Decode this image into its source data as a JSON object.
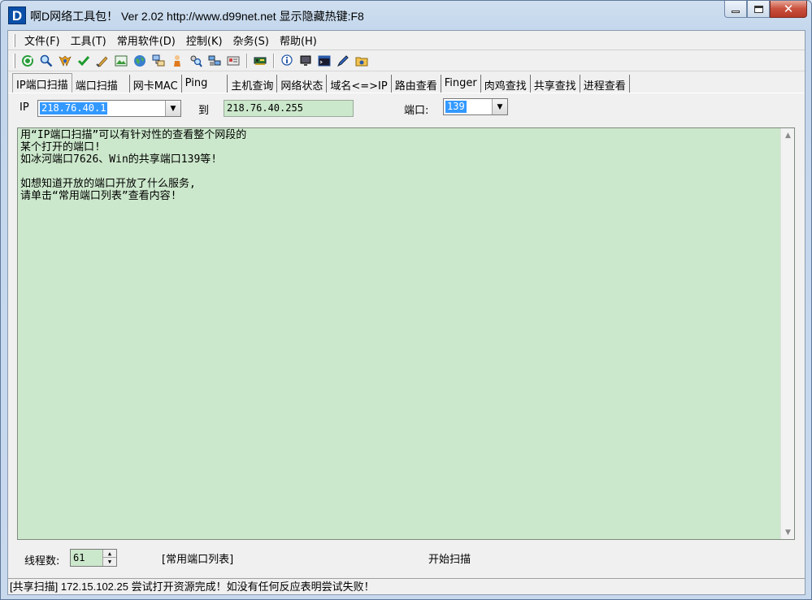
{
  "window": {
    "logo_letter": "D",
    "title": "啊D网络工具包！ Ver 2.02   http://www.d99net.net  显示隐藏热键:F8"
  },
  "menu": [
    "文件(F)",
    "工具(T)",
    "常用软件(D)",
    "控制(K)",
    "杂务(S)",
    "帮助(H)"
  ],
  "toolbar": {
    "icons": [
      "refresh-icon",
      "search-icon",
      "antivirus-icon",
      "check-icon",
      "brush-icon",
      "image-icon",
      "globe-icon",
      "network-copy-icon",
      "user-icon",
      "user-search-icon",
      "computers-icon",
      "card-icon",
      "network-card-icon",
      "info-icon",
      "monitor-icon",
      "terminal-icon",
      "pen-icon",
      "folder-share-icon"
    ]
  },
  "tabs": [
    "IP端口扫描",
    "端口扫描",
    "网卡MAC",
    "Ping",
    "主机查询",
    "网络状态",
    "域名<=>IP",
    "路由查看",
    "Finger",
    "肉鸡查找",
    "共享查找",
    "进程查看"
  ],
  "scan": {
    "ip_label": "IP",
    "ip_start": "218.76.40.1",
    "to_label": "到",
    "ip_end": "218.76.40.255",
    "port_label": "端口:",
    "port_value": "139"
  },
  "output_text": "用“IP端口扫描”可以有针对性的查看整个网段的\n某个打开的端口!\n如冰河端口7626、Win的共享端口139等!\n\n如想知道开放的端口开放了什么服务,\n请单击“常用端口列表”查看内容!",
  "bottom": {
    "threads_label": "线程数:",
    "threads_value": "61",
    "port_list_button": "[常用端口列表]",
    "start_button": "开始扫描"
  },
  "status": "[共享扫描] 172.15.102.25 尝试打开资源完成！如没有任何反应表明尝试失败！",
  "colors": {
    "field_green": "#cce8cc",
    "selection_blue": "#3399ff",
    "close_red": "#c9503d"
  }
}
